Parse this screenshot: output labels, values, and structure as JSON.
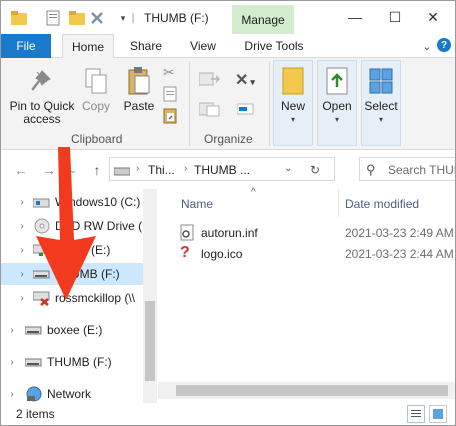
{
  "window": {
    "title": "THUMB (F:)",
    "contextual_tab": "Manage"
  },
  "title_controls": {
    "minimize": "—",
    "maximize": "☐",
    "close": "✕"
  },
  "tabs": [
    {
      "label": "File"
    },
    {
      "label": "Home"
    },
    {
      "label": "Share"
    },
    {
      "label": "View"
    },
    {
      "label": "Drive Tools"
    }
  ],
  "ribbon": {
    "clipboard": {
      "pin_line1": "Pin to Quick",
      "pin_line2": "access",
      "copy": "Copy",
      "paste": "Paste",
      "group": "Clipboard"
    },
    "organize": {
      "group": "Organize"
    },
    "new": "New",
    "open": "Open",
    "select": "Select"
  },
  "address": {
    "part1": "Thi...",
    "part2": "THUMB ...",
    "search_placeholder": "Search THUMB"
  },
  "nav_pane": {
    "items": [
      {
        "label": "Windows10 (C:)"
      },
      {
        "label": "DVD RW Drive (D"
      },
      {
        "label": "boxee (E:)"
      },
      {
        "label": "THUMB (F:)"
      },
      {
        "label": "rossmckillop (\\\\"
      },
      {
        "label": "boxee (E:)"
      },
      {
        "label": "THUMB (F:)"
      },
      {
        "label": "Network"
      }
    ]
  },
  "file_list": {
    "columns": {
      "name": "Name",
      "date": "Date modified"
    },
    "rows": [
      {
        "name": "autorun.inf",
        "date": "2021-03-23 2:49 AM"
      },
      {
        "name": "logo.ico",
        "date": "2021-03-23 2:44 AM"
      }
    ]
  },
  "status": {
    "count": "2 items"
  },
  "colors": {
    "accent": "#1979ca",
    "manage_tab": "#d3eccd",
    "selected": "#cce8ff",
    "arrow": "#f23a1f"
  }
}
